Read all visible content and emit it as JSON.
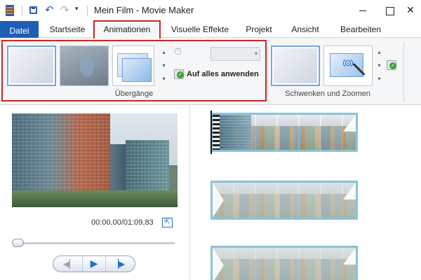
{
  "window": {
    "title": "Mein Film - Movie Maker",
    "close_glyph": "✕"
  },
  "quick_access": {
    "icons": [
      "movie-maker-app-icon",
      "save-icon",
      "undo-icon",
      "redo-icon",
      "customize-toolbar-icon"
    ],
    "undo_glyph": "↶",
    "redo_glyph": "↷",
    "more_glyph": "▾"
  },
  "tabs": {
    "file": "Datei",
    "items": [
      "Startseite",
      "Animationen",
      "Visuelle Effekte",
      "Projekt",
      "Ansicht",
      "Bearbeiten"
    ],
    "active": "Animationen"
  },
  "ribbon": {
    "transitions_group": "Übergänge",
    "apply_all": "Auf alles anwenden",
    "duration_value": "",
    "pan_zoom_group": "Schwenken und Zoomen",
    "scroll_up": "▴",
    "scroll_down": "▾",
    "scroll_more": "▾",
    "combo_arrow": "▾",
    "stopwatch_glyph": "⏱"
  },
  "preview": {
    "timecode": "00:00,00/01:09,83",
    "fullscreen_glyph": "⇱",
    "seek_position": 0.0,
    "prev_glyph": "◀▏",
    "play_glyph": "▶",
    "next_glyph": "▕▶"
  },
  "storyboard": {
    "clip_count_visible": 3,
    "selected_clip": 1
  },
  "colors": {
    "file_tab": "#1e5fb5",
    "highlight_border": "#c72a2a",
    "clip_border": "#8cc3d8",
    "accent_blue": "#1e6fd0"
  }
}
